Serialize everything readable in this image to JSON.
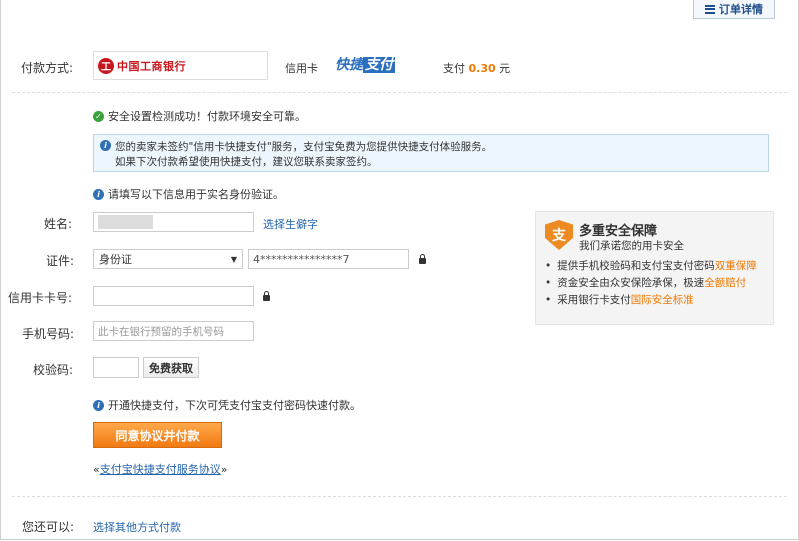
{
  "header": {
    "order_detail_label": "订单详情"
  },
  "payment": {
    "method_label": "付款方式:",
    "bank_name": "中国工商银行",
    "card_type": "信用卡",
    "quick_pay_prefix": "快捷",
    "quick_pay_suffix": "支付",
    "amount_prefix": "支付",
    "amount": "0.30",
    "amount_unit": "元"
  },
  "messages": {
    "security_ok": "安全设置检测成功！付款环境安全可靠。",
    "notice_line1": "您的卖家未签约\"信用卡快捷支付\"服务，支付宝免费为您提供快捷支付体验服务。",
    "notice_line2": "如果下次付款希望使用快捷支付，建议您联系卖家签约。",
    "fill_info": "请填写以下信息用于实名身份验证。",
    "open_quick_pay": "开通快捷支付，下次可凭支付宝支付密码快速付款。"
  },
  "form": {
    "name_label": "姓名:",
    "rare_char_link": "选择生僻字",
    "id_label": "证件:",
    "id_type": "身份证",
    "id_number": "4***************7",
    "card_number_label": "信用卡卡号:",
    "phone_label": "手机号码:",
    "phone_placeholder": "此卡在银行预留的手机号码",
    "verify_code_label": "校验码:",
    "fetch_code_button": "免费获取",
    "submit_button": "同意协议并付款",
    "agreement_link": "支付宝快捷支付服务协议"
  },
  "security_panel": {
    "title": "多重安全保障",
    "subtitle": "我们承诺您的用卡安全",
    "items": [
      {
        "text": "提供手机校验码和支付宝支付密码",
        "highlight": "双重保障"
      },
      {
        "text": "资金安全由众安保险承保，极速",
        "highlight": "全额赔付"
      },
      {
        "text": "采用银行卡支付",
        "highlight": "国际安全标准"
      }
    ]
  },
  "footer": {
    "other_label": "您还可以:",
    "other_method_link": "选择其他方式付款"
  },
  "colors": {
    "accent_orange": "#f07800",
    "link_blue": "#2565ad",
    "bank_red": "#c8161e"
  }
}
